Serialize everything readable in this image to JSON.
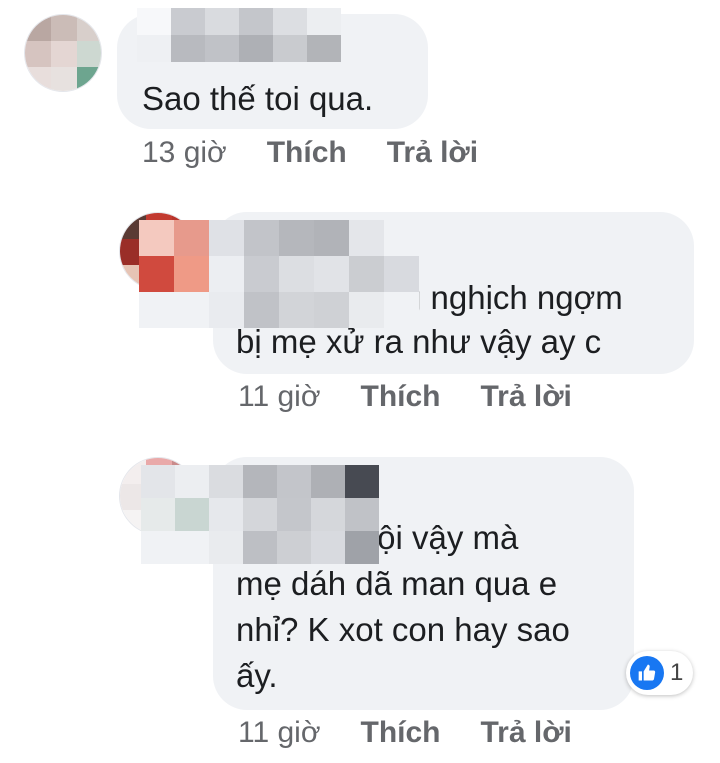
{
  "comments": [
    {
      "text": "Sao thế toi qua.",
      "time": "13 giờ",
      "like_label": "Thích",
      "reply_label": "Trả lời"
    },
    {
      "text_line1": "g nghịch ngợm",
      "text_line2": "bị mẹ xử ra như vậy ay c",
      "time": "11 giờ",
      "like_label": "Thích",
      "reply_label": "Trả lời"
    },
    {
      "text_line1": "tội vậy mà",
      "text_line2": "mẹ dáh dã man qua e",
      "text_line3": "nhỉ? K xot con hay sao",
      "text_line4": "ấy.",
      "time": "11 giờ",
      "like_label": "Thích",
      "reply_label": "Trả lời",
      "reaction_icon": "like-icon",
      "reaction_count": "1"
    }
  ],
  "colors": {
    "bubble_bg": "#f0f2f5",
    "meta_text": "#65676b",
    "like_blue": "#1877f2"
  }
}
